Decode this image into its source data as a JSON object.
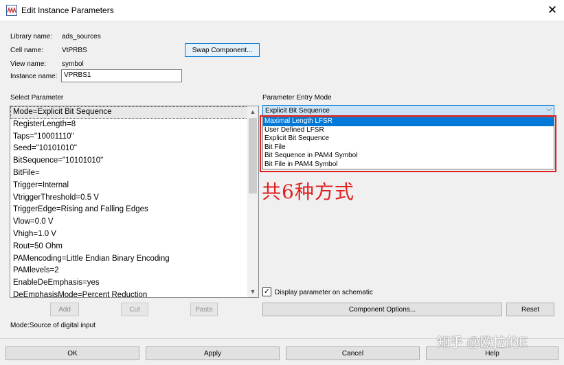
{
  "window": {
    "title": "Edit Instance Parameters",
    "close_symbol": "✕"
  },
  "info": {
    "library_label": "Library name:",
    "library_value": "ads_sources",
    "cell_label": "Cell name:",
    "cell_value": "VtPRBS",
    "view_label": "View name:",
    "view_value": "symbol",
    "instance_label": "Instance name:",
    "instance_value": "VPRBS1",
    "swap_button": "Swap Component..."
  },
  "parameters": {
    "heading": "Select Parameter",
    "items": [
      "Mode=Explicit Bit Sequence",
      "RegisterLength=8",
      "Taps=\"10001110\"",
      "Seed=\"10101010\"",
      "BitSequence=\"10101010\"",
      "BitFile=",
      "Trigger=Internal",
      "VtriggerThreshold=0.5 V",
      "TriggerEdge=Rising and Falling Edges",
      "Vlow=0.0 V",
      "Vhigh=1.0 V",
      "Rout=50 Ohm",
      "PAMencoding=Little Endian Binary Encoding",
      "PAMlevels=2",
      "EnableDeEmphasis=yes",
      "DeEmphasisMode=Percent Reduction"
    ],
    "add_button": "Add",
    "cut_button": "Cut",
    "paste_button": "Paste",
    "description": "Mode:Source of digital input"
  },
  "entry_mode": {
    "heading": "Parameter Entry Mode",
    "selected": "Explicit Bit Sequence",
    "options": [
      "Maximal Length LFSR",
      "User Defined LFSR",
      "Explicit Bit Sequence",
      "Bit File",
      "Bit Sequence in PAM4 Symbol",
      "Bit File in PAM4 Symbol"
    ],
    "annotation": "共6种方式",
    "display_checkbox_label": "Display parameter on schematic",
    "display_checked": true,
    "component_options_button": "Component Options...",
    "reset_button": "Reset"
  },
  "footer": {
    "ok": "OK",
    "apply": "Apply",
    "cancel": "Cancel",
    "help": "Help"
  },
  "watermark": "知乎 @欧拉的E",
  "colors": {
    "accent": "#0078d7",
    "annotation_red": "#e02020",
    "dialog_bg": "#f0f0f0"
  }
}
